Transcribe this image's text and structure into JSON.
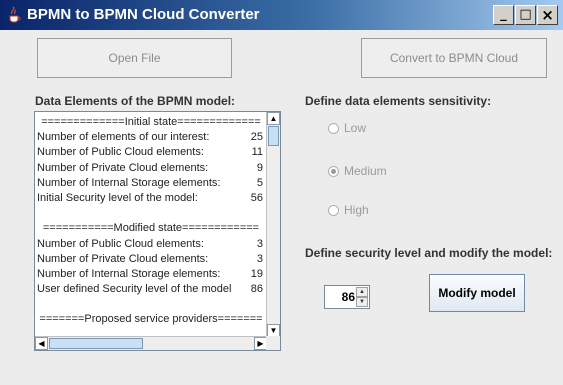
{
  "window": {
    "title": "BPMN to BPMN Cloud Converter",
    "controls": {
      "minimize": "_",
      "maximize": "□",
      "close": "×"
    }
  },
  "toolbar": {
    "open_file": "Open File",
    "convert": "Convert to BPMN Cloud"
  },
  "data_elements": {
    "heading": "Data Elements of the BPMN model:",
    "lines": [
      {
        "label": "=============Initial state=============",
        "value": ""
      },
      {
        "label": "Number of elements of our interest:",
        "value": "25"
      },
      {
        "label": "Number of Public Cloud elements:",
        "value": "11"
      },
      {
        "label": "Number of Private Cloud elements:",
        "value": "9"
      },
      {
        "label": "Number of Internal Storage elements:",
        "value": "5"
      },
      {
        "label": "Initial Security level of the model:",
        "value": "56"
      },
      {
        "label": "",
        "value": ""
      },
      {
        "label": "===========Modified state============",
        "value": ""
      },
      {
        "label": "Number of Public Cloud elements:",
        "value": "3"
      },
      {
        "label": "Number of Private Cloud elements:",
        "value": "3"
      },
      {
        "label": "Number of Internal Storage elements:",
        "value": "19"
      },
      {
        "label": "User defined Security level of the model:",
        "value": "86"
      },
      {
        "label": "",
        "value": ""
      },
      {
        "label": "=======Proposed service providers=======",
        "value": ""
      }
    ]
  },
  "sensitivity": {
    "heading": "Define data elements sensitivity:",
    "options": [
      "Low",
      "Medium",
      "High"
    ],
    "selected": "Medium"
  },
  "security": {
    "heading": "Define security level and modify the model:",
    "value": "86",
    "modify_button": "Modify model"
  },
  "icons": {
    "app": "java-coffee-icon",
    "scroll_up": "up-arrow-icon",
    "scroll_down": "down-arrow-icon",
    "scroll_left": "left-arrow-icon",
    "scroll_right": "right-arrow-icon"
  },
  "colors": {
    "titlebar_start": "#0a246a",
    "titlebar_end": "#a6caf0",
    "background": "#ececec"
  }
}
